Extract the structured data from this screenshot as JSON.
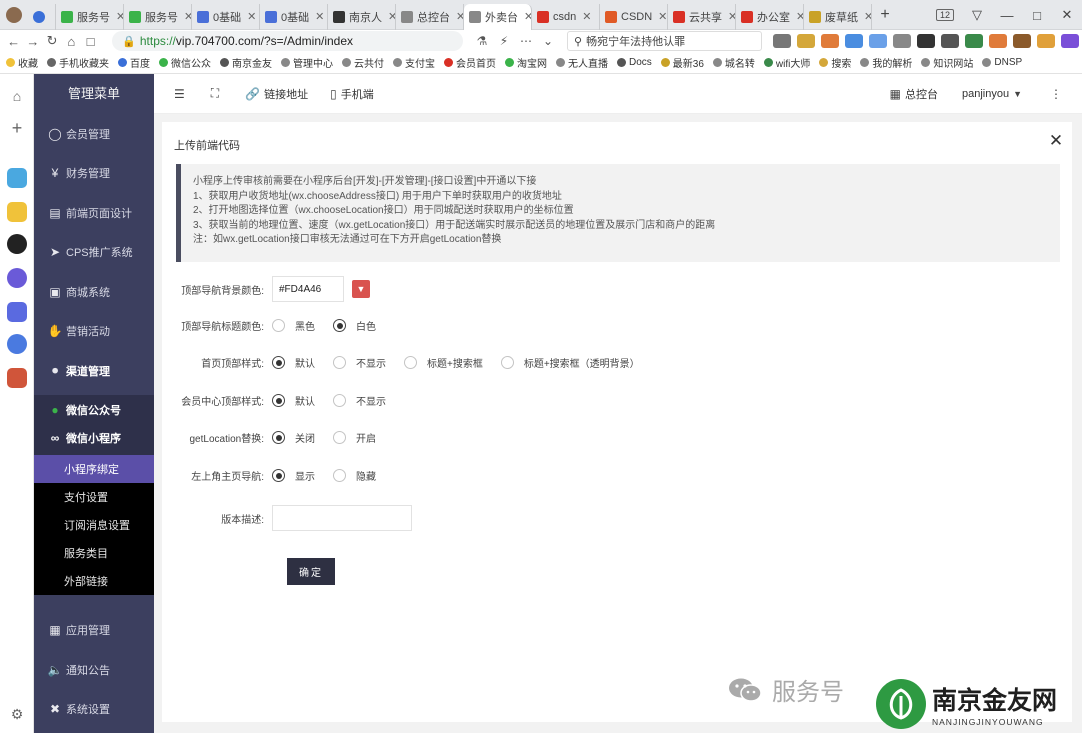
{
  "browser": {
    "tabs": [
      {
        "label": "服务号",
        "color": "#3bb34a"
      },
      {
        "label": "服务号",
        "color": "#3bb34a"
      },
      {
        "label": "0基础",
        "color": "#4a6fd8"
      },
      {
        "label": "0基础",
        "color": "#4a6fd8"
      },
      {
        "label": "南京人",
        "color": "#333333"
      },
      {
        "label": "总控台",
        "color": "#888888"
      },
      {
        "label": "外卖台",
        "color": "#888888"
      },
      {
        "label": "csdn",
        "color": "#d93025"
      },
      {
        "label": "CSDN",
        "color": "#e05a26"
      },
      {
        "label": "云共享",
        "color": "#d93025"
      },
      {
        "label": "办公室",
        "color": "#d93025"
      },
      {
        "label": "废草纸",
        "color": "#c9a227"
      }
    ],
    "tab_count_badge": "12",
    "url_scheme": "https://",
    "url_rest": "vip.704700.com/?s=/Admin/index",
    "search_text": "畅宛宁年法持他认罪",
    "bookmarks": [
      "收藏",
      "手机收藏夹",
      "百度",
      "微信公众",
      "南京金友",
      "管理中心",
      "云共付",
      "支付宝",
      "会员首页",
      "淘宝网",
      "无人直播",
      "Docs",
      "最新36",
      "城名转",
      "wifi大师",
      "搜索",
      "我的解析",
      "知识网站",
      "DNSP"
    ]
  },
  "menu": {
    "title": "管理菜单",
    "items": [
      "会员管理",
      "财务管理",
      "前端页面设计",
      "CPS推广系统",
      "商城系统",
      "营销活动",
      "渠道管理"
    ],
    "sub_items": [
      "微信公众号",
      "微信小程序"
    ],
    "leaves": [
      "小程序绑定",
      "支付设置",
      "订阅消息设置",
      "服务类目",
      "外部链接"
    ],
    "bottom_items": [
      "应用管理",
      "通知公告",
      "系统设置"
    ]
  },
  "topnav": {
    "link_label": "链接地址",
    "mobile_label": "手机端",
    "console_label": "总控台",
    "user": "panjinyou"
  },
  "panel": {
    "title": "上传前端代码",
    "notice": [
      "小程序上传审核前需要在小程序后台[开发]-[开发管理]-[接口设置]中开通以下接",
      "1、获取用户收货地址(wx.chooseAddress接口) 用于用户下单时获取用户的收货地址",
      "2、打开地图选择位置（wx.chooseLocation接口）用于同城配送时获取用户的坐标位置",
      "3、获取当前的地理位置、速度（wx.getLocation接口）用于配送端实时展示配送员的地理位置及展示门店和商户的距离",
      "注：如wx.getLocation接口审核无法通过可在下方开启getLocation替换"
    ],
    "fields": {
      "nav_bg_color": {
        "label": "顶部导航背景颜色:",
        "value": "#FD4A46"
      },
      "nav_title_color": {
        "label": "顶部导航标题颜色:",
        "options": [
          "黑色",
          "白色"
        ],
        "selected": "白色"
      },
      "home_top_style": {
        "label": "首页顶部样式:",
        "options": [
          "默认",
          "不显示",
          "标题+搜索框",
          "标题+搜索框（透明背景）"
        ],
        "selected": "默认"
      },
      "member_top_style": {
        "label": "会员中心顶部样式:",
        "options": [
          "默认",
          "不显示"
        ],
        "selected": "默认"
      },
      "getlocation": {
        "label": "getLocation替换:",
        "options": [
          "关闭",
          "开启"
        ],
        "selected": "关闭"
      },
      "home_nav": {
        "label": "左上角主页导航:",
        "options": [
          "显示",
          "隐藏"
        ],
        "selected": "显示"
      },
      "version_desc": {
        "label": "版本描述:",
        "value": ""
      }
    },
    "ok_label": "确定"
  },
  "watermark": {
    "service_text": "服务号",
    "brand_cn": "南京金友网",
    "brand_en": "NANJINGJINYOUWANG"
  },
  "colors": {
    "menu_bg": "#3c3f5f",
    "menu_active": "#5b4fa8",
    "swatch": "#d9534f",
    "wechat_green": "#3bb34a"
  }
}
